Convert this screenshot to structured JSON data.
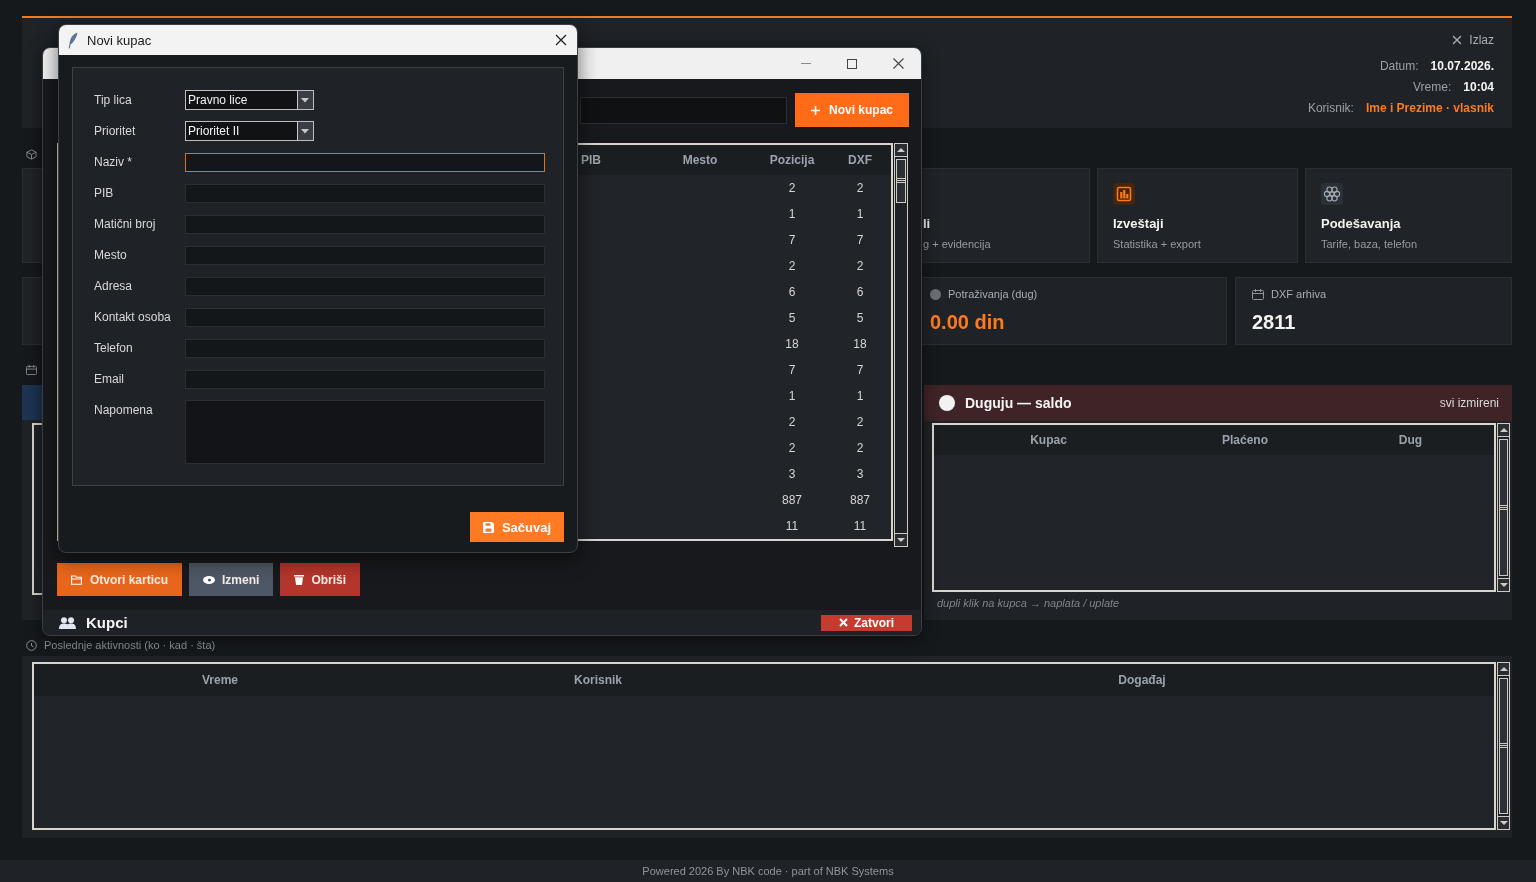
{
  "dashboard": {
    "header": {
      "exit": "Izlaz",
      "info": [
        {
          "kind": "text",
          "label": "Datum:",
          "value": "10.07.2026."
        },
        {
          "kind": "text",
          "label": "Vreme:",
          "value": "10:04"
        },
        {
          "kind": "user",
          "label": "Korisnik:",
          "value": "Ime i Prezime · vlasnik"
        }
      ]
    },
    "cards": [
      {
        "kind": "clipped",
        "title": "li",
        "subtitle": "g + evidencija"
      },
      {
        "kind": "reports",
        "title": "Izveštaji",
        "subtitle": "Statistika + export"
      },
      {
        "kind": "settings",
        "title": "Podešavanja",
        "subtitle": "Tarife, baza, telefon"
      }
    ],
    "stats": [
      {
        "kind": "debt",
        "label": "Potraživanja (dug)",
        "value": "0.00 din"
      },
      {
        "kind": "archive",
        "label": "DXF arhiva",
        "value": "2811"
      }
    ],
    "debts_panel": {
      "title": "Duguju — saldo",
      "status": "svi izmireni",
      "columns": [
        "Kupac",
        "Plaćeno",
        "Dug"
      ],
      "hint": "dupli klik na kupca → naplata / uplate"
    },
    "activity": {
      "title": "Poslednje aktivnosti (ko · kad · šta)",
      "columns": [
        "Vreme",
        "Korisnik",
        "Događaj"
      ]
    }
  },
  "footer": {
    "text": "Powered 2026 By NBK code · part of NBK Systems"
  },
  "customers_window": {
    "title": "Kupci",
    "new_button": "Novi kupac",
    "table": {
      "columns": [
        "PIB",
        "Mesto",
        "Pozicija",
        "DXF"
      ],
      "rows": [
        {
          "pozicija": "2",
          "dxf": "2"
        },
        {
          "pozicija": "1",
          "dxf": "1"
        },
        {
          "pozicija": "7",
          "dxf": "7"
        },
        {
          "pozicija": "2",
          "dxf": "2"
        },
        {
          "pozicija": "6",
          "dxf": "6"
        },
        {
          "pozicija": "5",
          "dxf": "5"
        },
        {
          "pozicija": "18",
          "dxf": "18"
        },
        {
          "pozicija": "7",
          "dxf": "7"
        },
        {
          "pozicija": "1",
          "dxf": "1"
        },
        {
          "pozicija": "2",
          "dxf": "2"
        },
        {
          "pozicija": "2",
          "dxf": "2"
        },
        {
          "pozicija": "3",
          "dxf": "3"
        },
        {
          "pozicija": "887",
          "dxf": "887"
        },
        {
          "pozicija": "11",
          "dxf": "11"
        }
      ]
    },
    "actions": [
      {
        "kind": "primary",
        "label": "Otvori karticu"
      },
      {
        "kind": "secondary",
        "label": "Izmeni"
      },
      {
        "kind": "danger",
        "label": "Obriši"
      }
    ],
    "close_button": "Zatvori"
  },
  "new_customer_dialog": {
    "title": "Novi kupac",
    "fields": [
      {
        "kind": "select",
        "label": "Tip lica",
        "value": "Pravno lice",
        "focused": false
      },
      {
        "kind": "select",
        "label": "Prioritet",
        "value": "Prioritet II",
        "focused": false
      },
      {
        "kind": "text",
        "label": "Naziv *",
        "focused": true
      },
      {
        "kind": "text",
        "label": "PIB",
        "focused": false
      },
      {
        "kind": "text",
        "label": "Matični broj",
        "focused": false
      },
      {
        "kind": "text",
        "label": "Mesto",
        "focused": false
      },
      {
        "kind": "text",
        "label": "Adresa",
        "focused": false
      },
      {
        "kind": "text",
        "label": "Kontakt osoba",
        "focused": false
      },
      {
        "kind": "text",
        "label": "Telefon",
        "focused": false
      },
      {
        "kind": "text",
        "label": "Email",
        "focused": false
      },
      {
        "kind": "textarea",
        "label": "Napomena",
        "focused": false
      }
    ],
    "save_button": "Sačuvaj"
  }
}
